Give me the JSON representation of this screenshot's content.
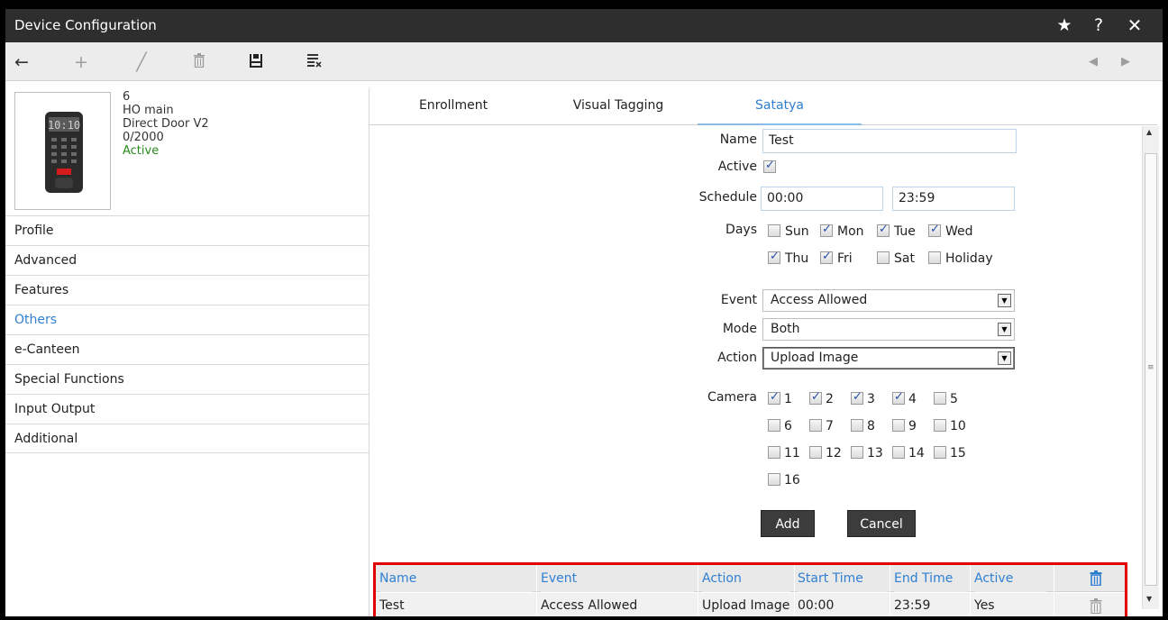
{
  "window": {
    "title": "Device Configuration"
  },
  "device": {
    "id": "6",
    "name": "HO main",
    "model": "Direct Door V2",
    "users": "0/2000",
    "status": "Active",
    "screen_text": "10:10"
  },
  "menu": [
    "Profile",
    "Advanced",
    "Features",
    "Others",
    "e-Canteen",
    "Special Functions",
    "Input Output",
    "Additional"
  ],
  "menu_selected": "Others",
  "tabs": [
    "Enrollment",
    "Visual Tagging",
    "Satatya"
  ],
  "form": {
    "name_label": "Name",
    "name_value": "Test",
    "active_label": "Active",
    "schedule_label": "Schedule",
    "schedule_start": "00:00",
    "schedule_end": "23:59",
    "days_label": "Days",
    "days": [
      {
        "label": "Sun",
        "checked": false
      },
      {
        "label": "Mon",
        "checked": true
      },
      {
        "label": "Tue",
        "checked": true
      },
      {
        "label": "Wed",
        "checked": true
      },
      {
        "label": "Thu",
        "checked": true
      },
      {
        "label": "Fri",
        "checked": true
      },
      {
        "label": "Sat",
        "checked": false
      },
      {
        "label": "Holiday",
        "checked": false
      }
    ],
    "event_label": "Event",
    "event_value": "Access Allowed",
    "mode_label": "Mode",
    "mode_value": "Both",
    "action_label": "Action",
    "action_value": "Upload Image",
    "camera_label": "Camera",
    "cameras": [
      "1",
      "2",
      "3",
      "4",
      "5",
      "6",
      "7",
      "8",
      "9",
      "10",
      "11",
      "12",
      "13",
      "14",
      "15",
      "16"
    ],
    "add_label": "Add",
    "cancel_label": "Cancel"
  },
  "table": {
    "headers": [
      "Name",
      "Event",
      "Action",
      "Start Time",
      "End Time",
      "Active"
    ],
    "row": [
      "Test",
      "Access Allowed",
      "Upload Image",
      "00:00",
      "23:59",
      "Yes"
    ]
  },
  "colors": {
    "titlebar": "#2e2e2e",
    "accent": "#2f7fd1",
    "active_green": "#2a8a1e",
    "highlight_border": "#e00000"
  }
}
